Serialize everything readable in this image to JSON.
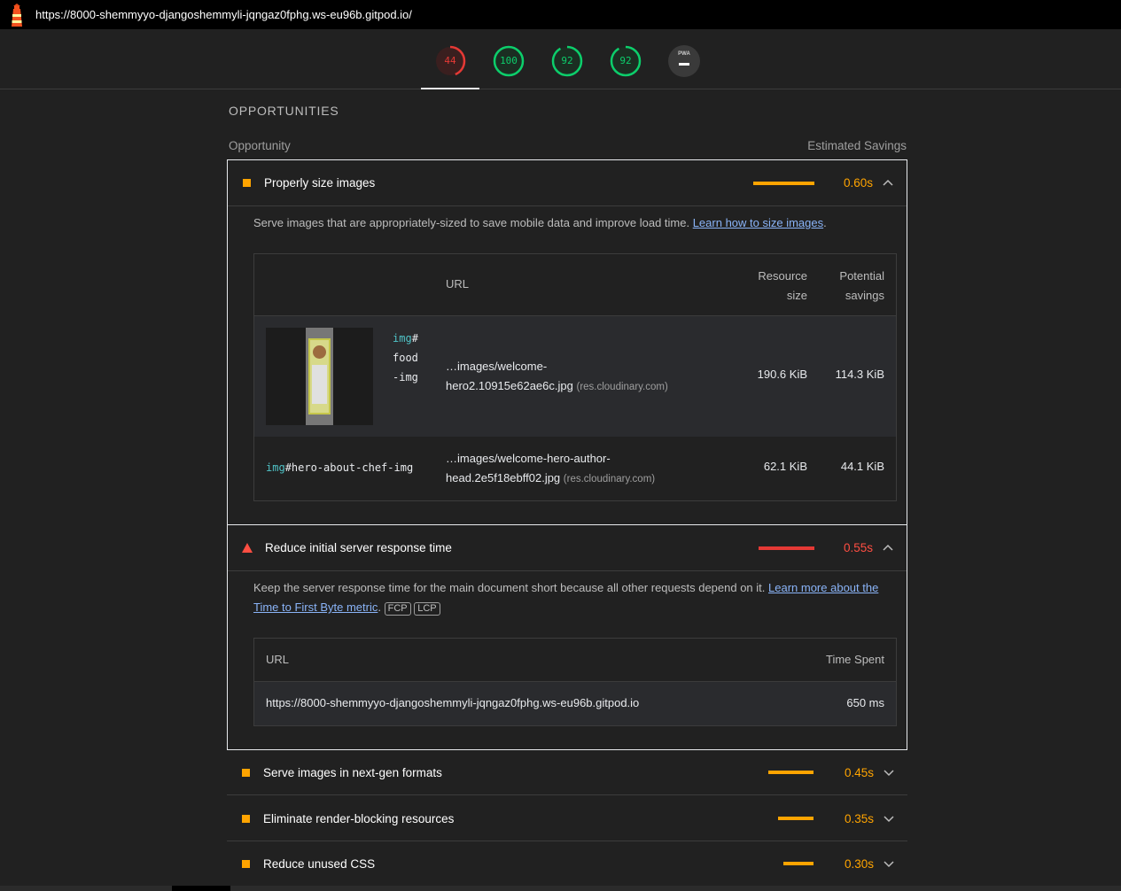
{
  "topbar": {
    "url": "https://8000-shemmyyo-djangoshemmyli-jqngaz0fphg.ws-eu96b.gitpod.io/"
  },
  "gauges": [
    {
      "score": "44",
      "color": "#e53935",
      "percent": 44
    },
    {
      "score": "100",
      "color": "#0cce6b",
      "percent": 100
    },
    {
      "score": "92",
      "color": "#0cce6b",
      "percent": 92
    },
    {
      "score": "92",
      "color": "#0cce6b",
      "percent": 92
    }
  ],
  "pwa": {
    "label": "PWA"
  },
  "section": {
    "title": "OPPORTUNITIES",
    "col_left": "Opportunity",
    "col_right": "Estimated Savings"
  },
  "audits": {
    "a1": {
      "title": "Properly size images",
      "savings": "0.60s",
      "desc": "Serve images that are appropriately-sized to save mobile data and improve load time. ",
      "link": "Learn how to size images",
      "desc_end": ".",
      "table": {
        "h_url": "URL",
        "h_size_1": "Resource",
        "h_size_2": "size",
        "h_sav_1": "Potential",
        "h_sav_2": "savings",
        "rows": [
          {
            "node_tag": "img",
            "node_hash": "#",
            "node_id_1": "food",
            "node_id_2": "-img",
            "url_1": "…images/welcome-",
            "url_2": "hero2.10915e62ae6c.jpg",
            "host": "(res.cloudinary.com)",
            "size": "190.6 KiB",
            "savings": "114.3 KiB"
          },
          {
            "node_tag": "img",
            "node_rest": "#hero-about-chef-img",
            "url_1": "…images/welcome-hero-author-",
            "url_2": "head.2e5f18ebff02.jpg",
            "host": "(res.cloudinary.com)",
            "size": "62.1 KiB",
            "savings": "44.1 KiB"
          }
        ]
      }
    },
    "a2": {
      "title": "Reduce initial server response time",
      "savings": "0.55s",
      "desc": "Keep the server response time for the main document short because all other requests depend on it. ",
      "link_1": "Learn more about the",
      "link_2": "Time to First Byte metric",
      "desc_end": ".",
      "tag_1": "FCP",
      "tag_2": "LCP",
      "table": {
        "h_url": "URL",
        "h_time": "Time Spent",
        "url": "https://8000-shemmyyo-djangoshemmyli-jqngaz0fphg.ws-eu96b.gitpod.io",
        "time": "650 ms"
      }
    },
    "a3": {
      "title": "Serve images in next-gen formats",
      "savings": "0.45s"
    },
    "a4": {
      "title": "Eliminate render-blocking resources",
      "savings": "0.35s"
    },
    "a5": {
      "title": "Reduce unused CSS",
      "savings": "0.30s"
    }
  },
  "colors": {
    "average": "#ffa400",
    "fail": "#ff4e42",
    "pass": "#0cce6b"
  }
}
